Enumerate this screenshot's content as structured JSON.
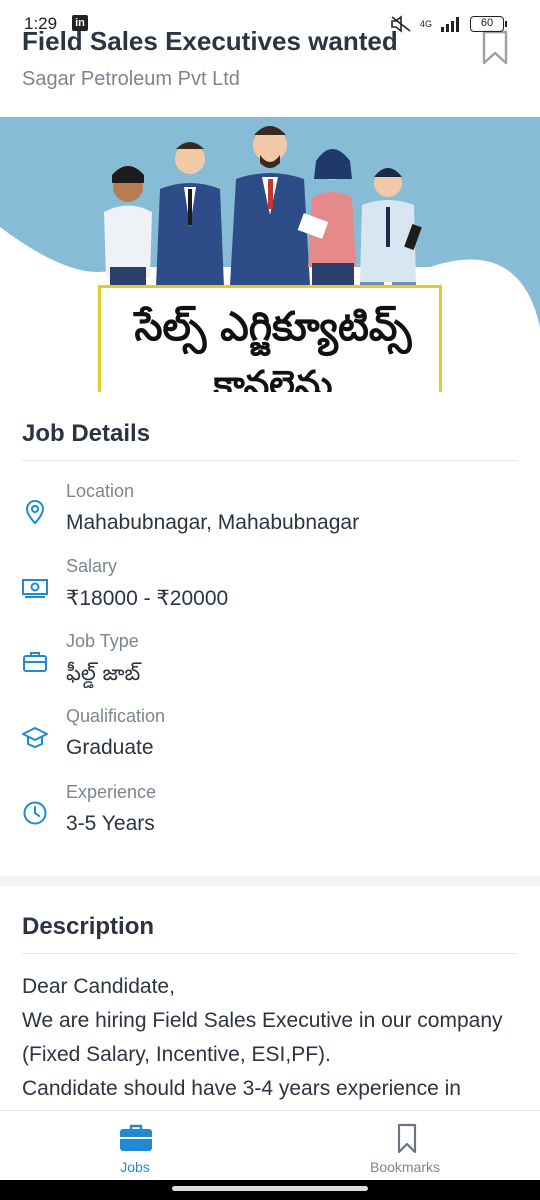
{
  "status_bar": {
    "time": "1:29",
    "network": "4G",
    "battery": "60"
  },
  "header": {
    "title": "Field Sales Executives wanted",
    "company": "Sagar Petroleum Pvt Ltd",
    "bookmark_icon": "bookmark-icon"
  },
  "banner": {
    "caption_line1": "సేల్స్ ఎగ్జిక్యూటివ్స్",
    "caption_line2": "కావలెను"
  },
  "job_details": {
    "title": "Job Details",
    "items": [
      {
        "label": "Location",
        "value": "Mahabubnagar, Mahabubnagar",
        "icon": "location-pin-icon"
      },
      {
        "label": "Salary",
        "value": "₹18000 - ₹20000",
        "icon": "money-icon"
      },
      {
        "label": "Job Type",
        "value": "ఫీల్డ్ జాబ్",
        "icon": "briefcase-icon"
      },
      {
        "label": "Qualification",
        "value": "Graduate",
        "icon": "graduation-cap-icon"
      },
      {
        "label": "Experience",
        "value": "3-5 Years",
        "icon": "clock-icon"
      }
    ]
  },
  "description": {
    "title": "Description",
    "text": "Dear Candidate,\n We are hiring Field Sales Executive in our company (Fixed Salary, Incentive, ESI,PF).\n Candidate should have 3-4 years experience in"
  },
  "bottom_nav": {
    "items": [
      {
        "label": "Jobs",
        "icon": "briefcase-icon",
        "active": true
      },
      {
        "label": "Bookmarks",
        "icon": "bookmark-icon",
        "active": false
      }
    ]
  },
  "colors": {
    "accent": "#1f8ad1",
    "text": "#2b3440",
    "muted": "#7c8590",
    "banner_bg": "#86bcd5"
  }
}
